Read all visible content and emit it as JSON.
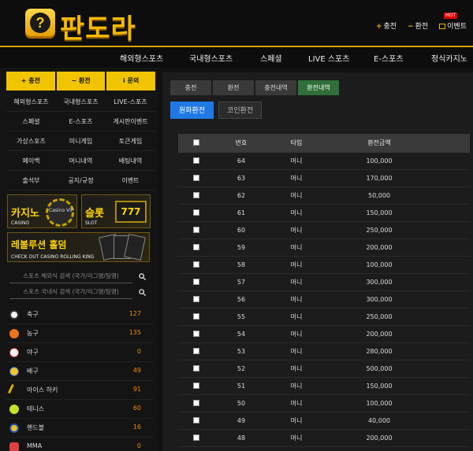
{
  "header": {
    "logo_text": "판도라",
    "logo_glyph": "?",
    "links": {
      "charge": "충전",
      "exchange": "환전",
      "event": "이벤트",
      "hot": "HOT"
    }
  },
  "nav": [
    "해외형스포츠",
    "국내형스포츠",
    "스페셜",
    "LIVE 스포츠",
    "E-스포츠",
    "정식카지노"
  ],
  "sidebar": {
    "top_buttons": [
      "충전",
      "환전",
      "문의"
    ],
    "top_icons": [
      "+",
      "−",
      "i"
    ],
    "grid": [
      [
        "해외형스포츠",
        "국내형스포츠",
        "LIVE-스포츠"
      ],
      [
        "스페셜",
        "E-스포츠",
        "게시판이벤트"
      ],
      [
        "가상스포츠",
        "미니게임",
        "토큰게임"
      ],
      [
        "페이백",
        "머니내역",
        "배팅내역"
      ],
      [
        "출석부",
        "공지/규정",
        "이벤트"
      ]
    ],
    "banners": {
      "casino_title": "카지노",
      "casino_sub": "CASINO",
      "casino_vip": "Casino VIP",
      "slot_title": "슬롯",
      "slot_sub": "SLOT",
      "slot_reels": "777",
      "rolling_title": "레볼루션 홀덤",
      "rolling_sub": "CHECK OUT CASINO ROLLING KING"
    },
    "search": [
      {
        "placeholder": "스포츠 해외식 검색 (국가/리그명/팀명)"
      },
      {
        "placeholder": "스포츠 국내식 검색 (국가/리그명/팀명)"
      }
    ],
    "sports": [
      {
        "name": "축구",
        "count": "127",
        "color": "#ffffff"
      },
      {
        "name": "농구",
        "count": "135",
        "color": "#e8741c"
      },
      {
        "name": "야구",
        "count": "0",
        "color": "#f3f3f3"
      },
      {
        "name": "배구",
        "count": "49",
        "color": "#f2c230"
      },
      {
        "name": "아이스 하키",
        "count": "91",
        "color": "#d9b000"
      },
      {
        "name": "테니스",
        "count": "60",
        "color": "#c6e02a"
      },
      {
        "name": "핸드볼",
        "count": "16",
        "color": "#e8c02a"
      },
      {
        "name": "MMA",
        "count": "0",
        "color": "#e04040"
      }
    ]
  },
  "content": {
    "tabs": [
      "충전",
      "환전",
      "충전내역",
      "환전내역"
    ],
    "active_tab": 3,
    "subtabs": [
      "원화환전",
      "코인환전"
    ],
    "table": {
      "headers": [
        "번호",
        "타입",
        "환전금액"
      ],
      "rows": [
        {
          "no": "64",
          "type": "머니",
          "amount": "100,000"
        },
        {
          "no": "63",
          "type": "머니",
          "amount": "170,000"
        },
        {
          "no": "62",
          "type": "머니",
          "amount": "50,000"
        },
        {
          "no": "61",
          "type": "머니",
          "amount": "150,000"
        },
        {
          "no": "60",
          "type": "머니",
          "amount": "250,000"
        },
        {
          "no": "59",
          "type": "머니",
          "amount": "200,000"
        },
        {
          "no": "58",
          "type": "머니",
          "amount": "100,000"
        },
        {
          "no": "57",
          "type": "머니",
          "amount": "300,000"
        },
        {
          "no": "56",
          "type": "머니",
          "amount": "300,000"
        },
        {
          "no": "55",
          "type": "머니",
          "amount": "250,000"
        },
        {
          "no": "54",
          "type": "머니",
          "amount": "200,000"
        },
        {
          "no": "53",
          "type": "머니",
          "amount": "280,000"
        },
        {
          "no": "52",
          "type": "머니",
          "amount": "500,000"
        },
        {
          "no": "51",
          "type": "머니",
          "amount": "150,000"
        },
        {
          "no": "50",
          "type": "머니",
          "amount": "100,000"
        },
        {
          "no": "49",
          "type": "머니",
          "amount": "40,000"
        },
        {
          "no": "48",
          "type": "머니",
          "amount": "200,000"
        }
      ]
    }
  },
  "colors": {
    "accent": "#f1c400",
    "active_tab": "#2f6f3a",
    "primary_button": "#1f78e6",
    "count": "#f08a18"
  }
}
